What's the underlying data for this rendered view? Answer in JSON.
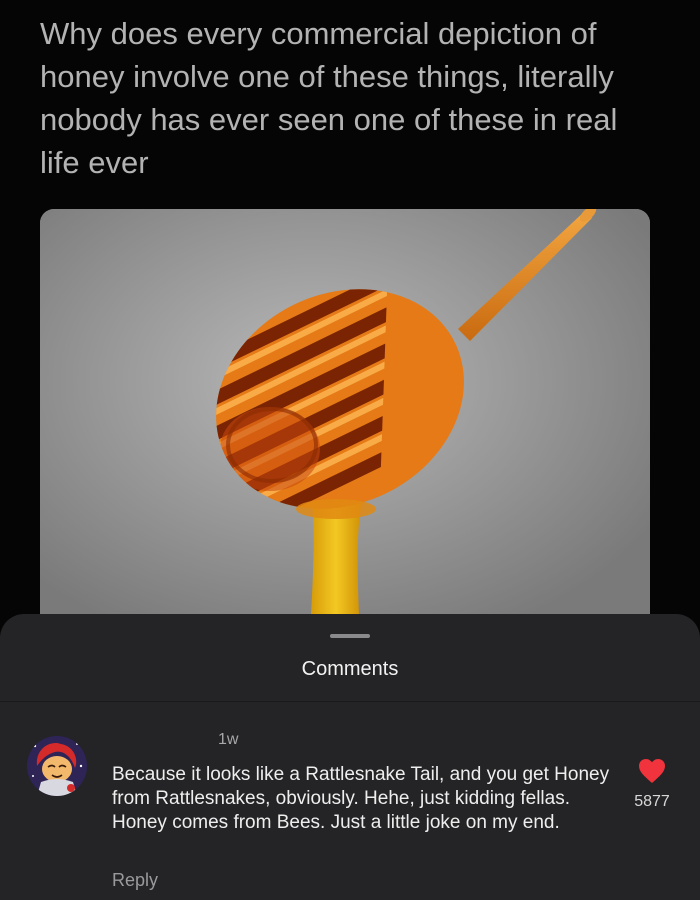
{
  "post": {
    "text": "Why does every commercial depiction of honey involve one of these things, literally nobody has ever seen one of these in real life ever",
    "media": {
      "subject": "honey dipper with dripping honey",
      "background_color": "#7d7d7d",
      "honey_color": "#e06a10"
    }
  },
  "comments_sheet": {
    "title": "Comments",
    "comments": [
      {
        "timestamp": "1w",
        "text": "Because it looks like a Rattlesnake Tail, and you get Honey from Rattlesnakes, obviously. Hehe, just kidding fellas. Honey comes from Bees. Just a little joke on my end.",
        "reply_label": "Reply",
        "like_count": "5877",
        "liked": true,
        "like_color": "#f0333c",
        "avatar_icon": "cartoon-avatar"
      }
    ]
  }
}
